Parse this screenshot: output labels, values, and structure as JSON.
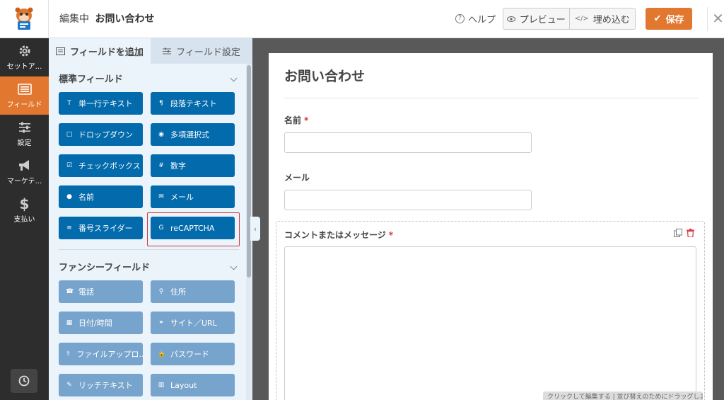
{
  "header": {
    "editing_label": "編集中",
    "form_title": "お問い合わせ",
    "help_label": "ヘルプ",
    "preview_label": "プレビュー",
    "embed_label": "埋め込む",
    "save_label": "保存"
  },
  "sidebar": {
    "items": [
      {
        "label": "セットア...",
        "icon": "gear-icon"
      },
      {
        "label": "フィールド",
        "icon": "fields-icon",
        "active": true
      },
      {
        "label": "設定",
        "icon": "sliders-icon"
      },
      {
        "label": "マーケテ...",
        "icon": "megaphone-icon"
      },
      {
        "label": "支払い",
        "icon": "dollar-icon"
      }
    ]
  },
  "panel": {
    "tab_add_fields": "フィールドを追加",
    "tab_field_options": "フィールド設定",
    "standard_section": "標準フィールド",
    "fancy_section": "ファンシーフィールド",
    "standard_fields": [
      {
        "label": "単一行テキスト",
        "icon": "T"
      },
      {
        "label": "段落テキスト",
        "icon": "¶"
      },
      {
        "label": "ドロップダウン",
        "icon": "▢"
      },
      {
        "label": "多項選択式",
        "icon": "◉"
      },
      {
        "label": "チェックボックス",
        "icon": "☑"
      },
      {
        "label": "数字",
        "icon": "#"
      },
      {
        "label": "名前",
        "icon": "●"
      },
      {
        "label": "メール",
        "icon": "✉"
      },
      {
        "label": "番号スライダー",
        "icon": "≡"
      },
      {
        "label": "reCAPTCHA",
        "icon": "G"
      }
    ],
    "fancy_fields": [
      {
        "label": "電話",
        "icon": "☎"
      },
      {
        "label": "住所",
        "icon": "⚲"
      },
      {
        "label": "日付/時間",
        "icon": "▦"
      },
      {
        "label": "サイト／URL",
        "icon": "⚭"
      },
      {
        "label": "ファイルアップロ...",
        "icon": "⇪"
      },
      {
        "label": "パスワード",
        "icon": "🔒"
      },
      {
        "label": "リッチテキスト",
        "icon": "✎"
      },
      {
        "label": "Layout",
        "icon": "▥"
      }
    ]
  },
  "form": {
    "title": "お問い合わせ",
    "fields": [
      {
        "label": "名前",
        "required": "*"
      },
      {
        "label": "メール",
        "required": ""
      },
      {
        "label": "コメントまたはメッセージ",
        "required": "*"
      }
    ],
    "drag_hint": "クリックして編集する | 並び替えのためにドラッグします"
  },
  "colors": {
    "accent": "#e27730",
    "field_button": "#036aab",
    "fancy_button": "#77a4cd",
    "highlight": "#d63638"
  }
}
